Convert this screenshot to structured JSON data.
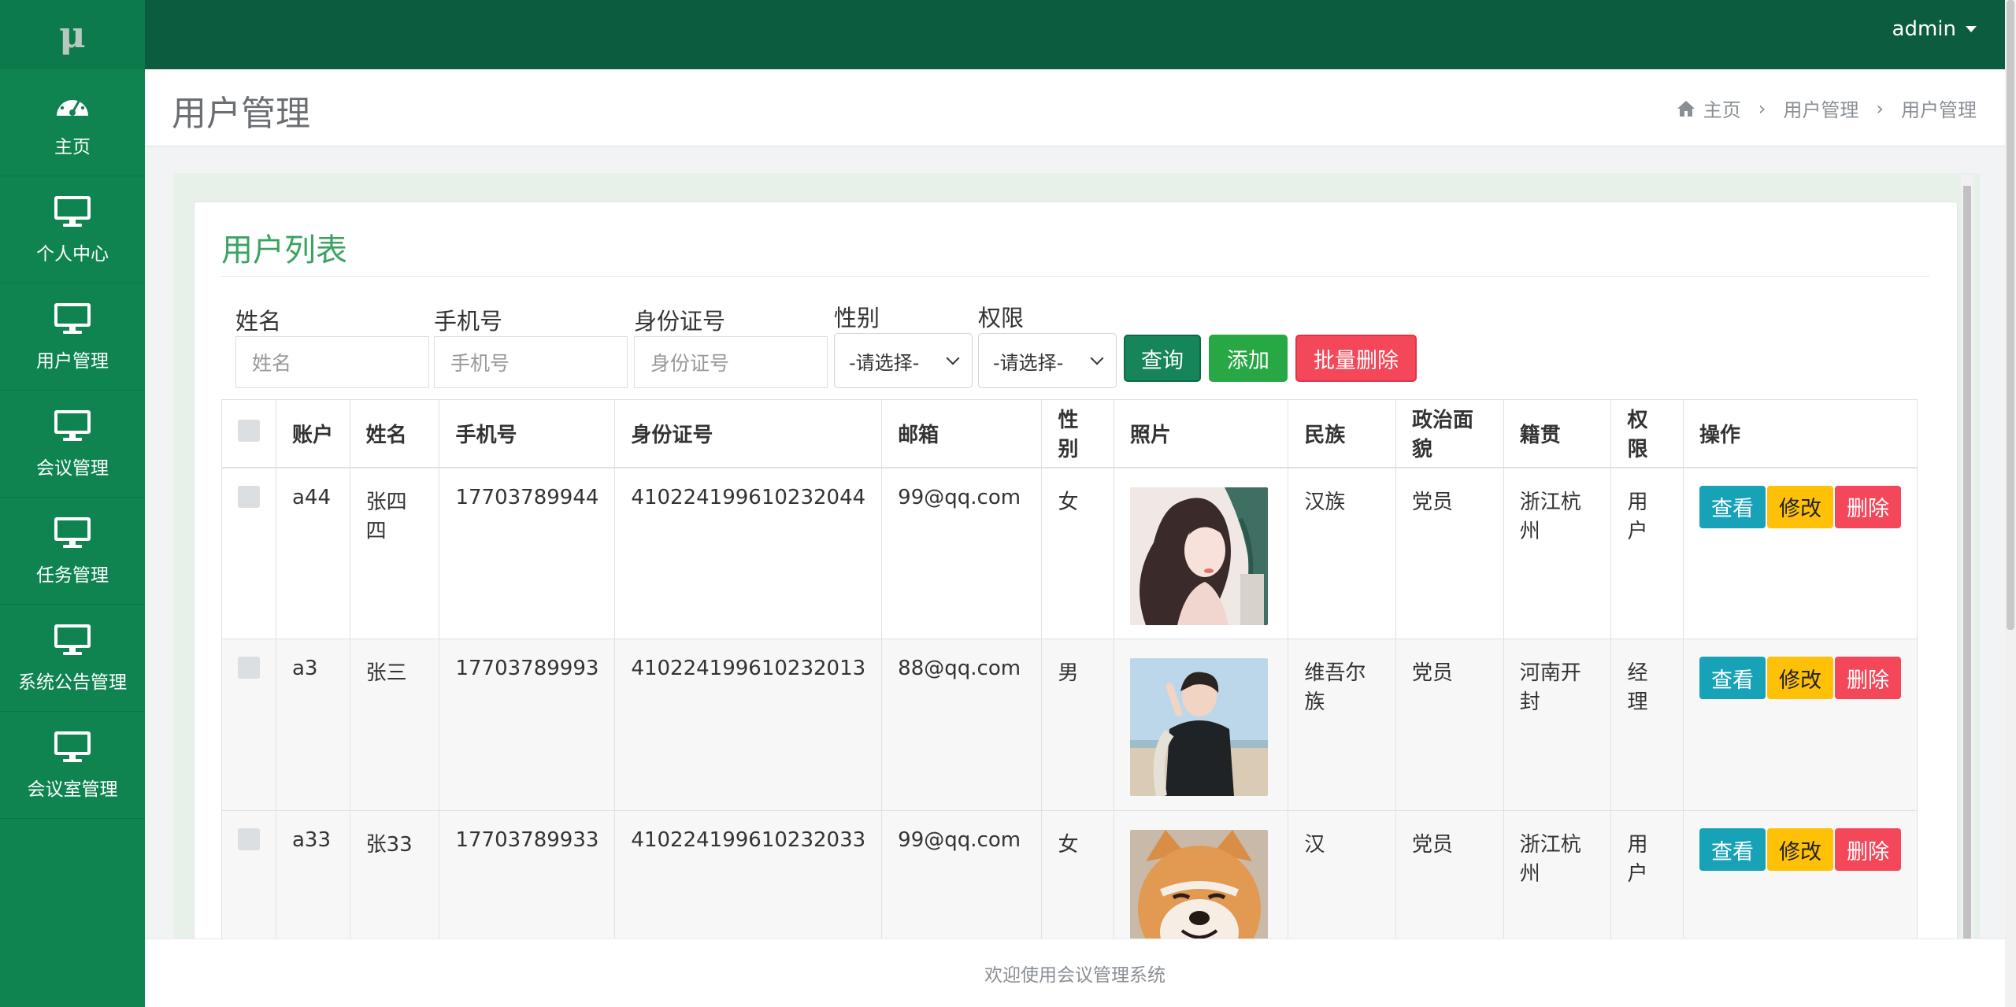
{
  "brand": {
    "logo_text": "μ"
  },
  "sidebar": {
    "items": [
      {
        "label": "主页",
        "icon": "dashboard-icon"
      },
      {
        "label": "个人中心",
        "icon": "monitor-icon"
      },
      {
        "label": "用户管理",
        "icon": "monitor-icon"
      },
      {
        "label": "会议管理",
        "icon": "monitor-icon"
      },
      {
        "label": "任务管理",
        "icon": "monitor-icon"
      },
      {
        "label": "系统公告管理",
        "icon": "monitor-icon"
      },
      {
        "label": "会议室管理",
        "icon": "monitor-icon"
      }
    ]
  },
  "topbar": {
    "user": "admin"
  },
  "header": {
    "title": "用户管理",
    "breadcrumb": [
      "主页",
      "用户管理",
      "用户管理"
    ]
  },
  "panel": {
    "title": "用户列表"
  },
  "filters": {
    "name": {
      "label": "姓名",
      "placeholder": "姓名"
    },
    "phone": {
      "label": "手机号",
      "placeholder": "手机号"
    },
    "idcard": {
      "label": "身份证号",
      "placeholder": "身份证号"
    },
    "gender": {
      "label": "性别",
      "selected": "-请选择-"
    },
    "role": {
      "label": "权限",
      "selected": "-请选择-"
    }
  },
  "buttons": {
    "query": "查询",
    "add": "添加",
    "batch_delete": "批量删除"
  },
  "table": {
    "columns": [
      "账户",
      "姓名",
      "手机号",
      "身份证号",
      "邮箱",
      "性别",
      "照片",
      "民族",
      "政治面貌",
      "籍贯",
      "权限",
      "操作"
    ],
    "rows": [
      {
        "account": "a44",
        "name": "张四四",
        "phone": "17703789944",
        "idcard": "410224199610232044",
        "email": "99@qq.com",
        "gender": "女",
        "photo": "portrait-woman-illustration",
        "ethnicity": "汉族",
        "political": "党员",
        "native": "浙江杭州",
        "role": "用户"
      },
      {
        "account": "a3",
        "name": "张三",
        "phone": "17703789993",
        "idcard": "410224199610232013",
        "email": "88@qq.com",
        "gender": "男",
        "photo": "portrait-man-beach",
        "ethnicity": "维吾尔族",
        "political": "党员",
        "native": "河南开封",
        "role": "经理"
      },
      {
        "account": "a33",
        "name": "张33",
        "phone": "17703789933",
        "idcard": "410224199610232033",
        "email": "99@qq.com",
        "gender": "女",
        "photo": "shiba-dog",
        "ethnicity": "汉",
        "political": "党员",
        "native": "浙江杭州",
        "role": "用户"
      }
    ],
    "actions": {
      "view": "查看",
      "edit": "修改",
      "delete": "删除"
    }
  },
  "footer": {
    "text": "欢迎使用会议管理系统"
  },
  "colors": {
    "sidebar": "#0f8451",
    "topbar": "#0c5c40",
    "accent": "#3aa361",
    "danger": "#f4485a",
    "warning": "#ffc107",
    "info": "#17a2b8"
  }
}
